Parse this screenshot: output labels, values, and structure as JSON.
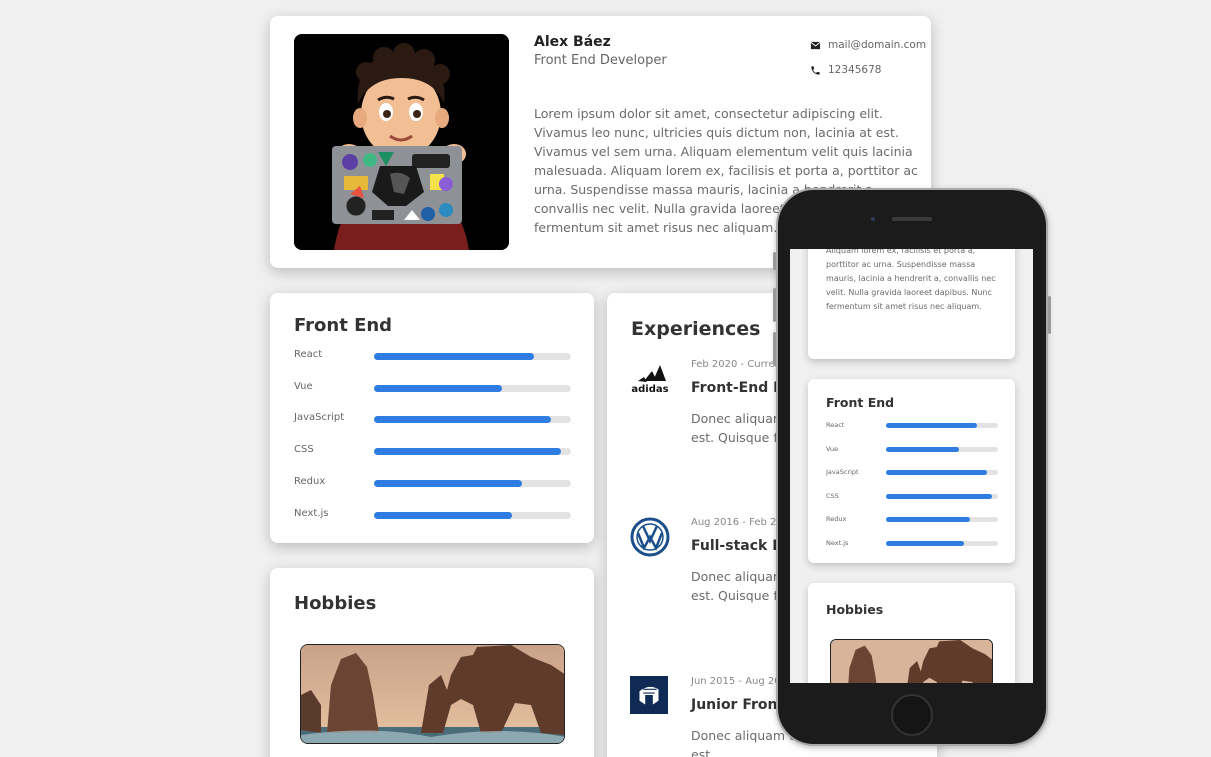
{
  "profile": {
    "name": "Alex Báez",
    "role": "Front End Developer",
    "email": "mail@domain.com",
    "phone": "12345678",
    "bio": "Lorem ipsum dolor sit amet, consectetur adipiscing elit. Vivamus leo nunc, ultricies quis dictum non, lacinia at est. Vivamus vel sem urna. Aliquam elementum velit quis lacinia malesuada. Aliquam lorem ex, facilisis et porta a, porttitor ac urna. Suspendisse massa mauris, lacinia a hendrerit a, convallis nec velit. Nulla gravida laoreet dapibus. Nunc fermentum sit amet risus nec aliquam."
  },
  "skills": {
    "title": "Front End",
    "items": [
      {
        "label": "React",
        "level": 0.81
      },
      {
        "label": "Vue",
        "level": 0.65
      },
      {
        "label": "JavaScript",
        "level": 0.9
      },
      {
        "label": "CSS",
        "level": 0.95
      },
      {
        "label": "Redux",
        "level": 0.75
      },
      {
        "label": "Next.js",
        "level": 0.7
      }
    ]
  },
  "hobbies": {
    "title": "Hobbies"
  },
  "experiences": {
    "title": "Experiences",
    "items": [
      {
        "logo": "adidas-logo",
        "date": "Feb 2020 - Current",
        "title": "Front-End Developer",
        "desc": "Donec aliquam ex, vestibulum dictum est. Quisque feugiat molestie."
      },
      {
        "logo": "volkswagen-logo",
        "date": "Aug 2016 - Feb 2020",
        "title": "Full-stack Developer",
        "desc": "Donec aliquam ex, vestibulum dictum est. Quisque feugiat molestie."
      },
      {
        "logo": "company-logo",
        "date": "Jun 2015 - Aug 2016",
        "title": "Junior Front-End Developer",
        "desc": "Donec aliquam ex, vestibulum dictum est."
      }
    ]
  },
  "mobile": {
    "bio": "Aliquam lorem ex, facilisis et porta a, porttitor ac urna. Suspendisse massa mauris, lacinia a hendrerit a, convallis nec velit. Nulla gravida laoreet dapibus. Nunc fermentum sit amet risus nec aliquam.",
    "skills_title": "Front End",
    "hobbies_title": "Hobbies"
  },
  "colors": {
    "accent": "#2f7de1",
    "track": "#e3e3e3",
    "background": "#f0f0f0"
  }
}
